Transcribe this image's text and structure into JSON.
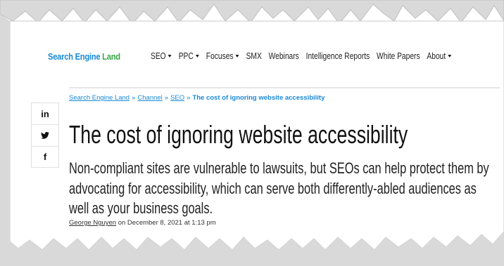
{
  "brand": {
    "primary": "Search Engine",
    "accent": "Land"
  },
  "nav": {
    "items": [
      {
        "label": "SEO",
        "dropdown": true
      },
      {
        "label": "PPC",
        "dropdown": true
      },
      {
        "label": "Focuses",
        "dropdown": true
      },
      {
        "label": "SMX",
        "dropdown": false
      },
      {
        "label": "Webinars",
        "dropdown": false
      },
      {
        "label": "Intelligence Reports",
        "dropdown": false
      },
      {
        "label": "White Papers",
        "dropdown": false
      },
      {
        "label": "About",
        "dropdown": true
      }
    ]
  },
  "breadcrumb": {
    "items": [
      "Search Engine Land",
      "Channel",
      "SEO"
    ],
    "separator": "»",
    "current": "The cost of ignoring website accessibility"
  },
  "share": {
    "linkedin": "in",
    "twitter": "🐦",
    "facebook": "f"
  },
  "article": {
    "title": "The cost of ignoring website accessibility",
    "subtitle": "Non-compliant sites are vulnerable to lawsuits, but SEOs can help protect them by advocating for accessibility, which can serve both differently-abled audiences as well as your business goals.",
    "author": "George Nguyen",
    "date_text": "on December 8, 2021 at 1:13 pm"
  },
  "colors": {
    "brand_blue": "#1a89d6",
    "brand_green": "#3aa84a",
    "torn_gray": "#d9d9d9"
  }
}
